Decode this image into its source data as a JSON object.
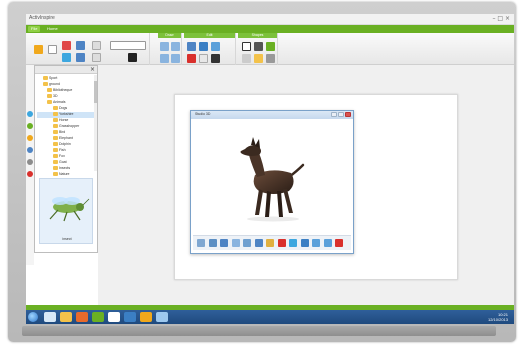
{
  "app": {
    "window_title": "ActivInspire",
    "window_controls": "– □ ×"
  },
  "ribbon": {
    "tabs": [
      "File",
      "Home"
    ],
    "groups": [
      "Select",
      "Draw",
      "Edit",
      "View",
      "Insert",
      "Shapes"
    ]
  },
  "explorer": {
    "close": "×",
    "tree": [
      "Sport",
      "ground",
      "Bibliotheque",
      "3D",
      "Animals",
      "Dogs",
      "Yorkshire",
      "Horse",
      "Grasshopper",
      "Bird",
      "Elephant",
      "Dolphin",
      "Fish",
      "Fox",
      "Goat",
      "Insects",
      "Nature"
    ],
    "selected_index": 6,
    "preview_label": "insect"
  },
  "viewer": {
    "title": "Studio 3D"
  },
  "taskbar": {
    "clock_time": "10:21",
    "clock_date": "12/10/2013"
  },
  "colors": {
    "accent_green": "#6ab023",
    "taskbar_blue": "#1f4a7e",
    "dog_brown": "#3b2a20"
  },
  "icons": {
    "viewer_toolbar": [
      "select-icon",
      "move-icon",
      "rotate-icon",
      "scale-icon",
      "texture-icon",
      "save-icon",
      "paint-icon",
      "color-icon",
      "play-icon",
      "stop-icon",
      "zoom-in-icon",
      "zoom-out-icon",
      "close-icon"
    ]
  }
}
